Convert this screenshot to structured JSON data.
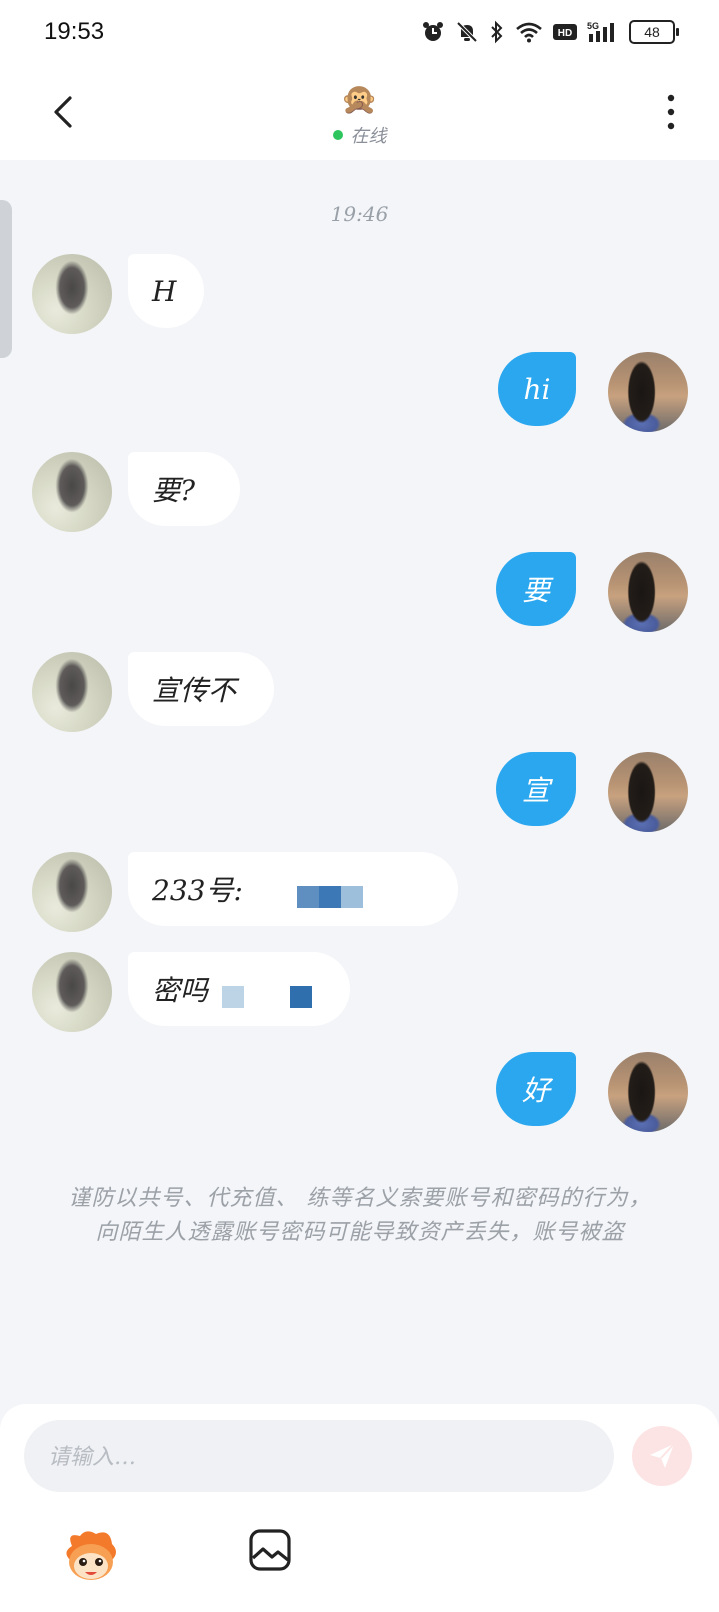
{
  "status_bar": {
    "time": "19:53",
    "battery": "48",
    "network": "5G",
    "hd": "HD"
  },
  "header": {
    "title_emoji": "🙊",
    "status": "在线"
  },
  "chat": {
    "timestamp": "19:46",
    "messages": [
      {
        "from": "other",
        "text": "H"
      },
      {
        "from": "self",
        "text": "hi"
      },
      {
        "from": "other",
        "text": "要?"
      },
      {
        "from": "self",
        "text": "要"
      },
      {
        "from": "other",
        "text": "宣传不"
      },
      {
        "from": "self",
        "text": "宣"
      },
      {
        "from": "other",
        "text": "233号:"
      },
      {
        "from": "other",
        "text": "密吗"
      },
      {
        "from": "self",
        "text": "好"
      }
    ],
    "warning": "谨防以共号、代充值、  练等名义索要账号和密码的行为，向陌生人透露账号密码可能导致资产丢失，账号被盗"
  },
  "composer": {
    "placeholder": "请输入…"
  },
  "colors": {
    "out_bubble": "#2aa7ee",
    "in_bubble": "#ffffff",
    "online": "#2ec55f",
    "send_bg": "#fde4e4"
  }
}
